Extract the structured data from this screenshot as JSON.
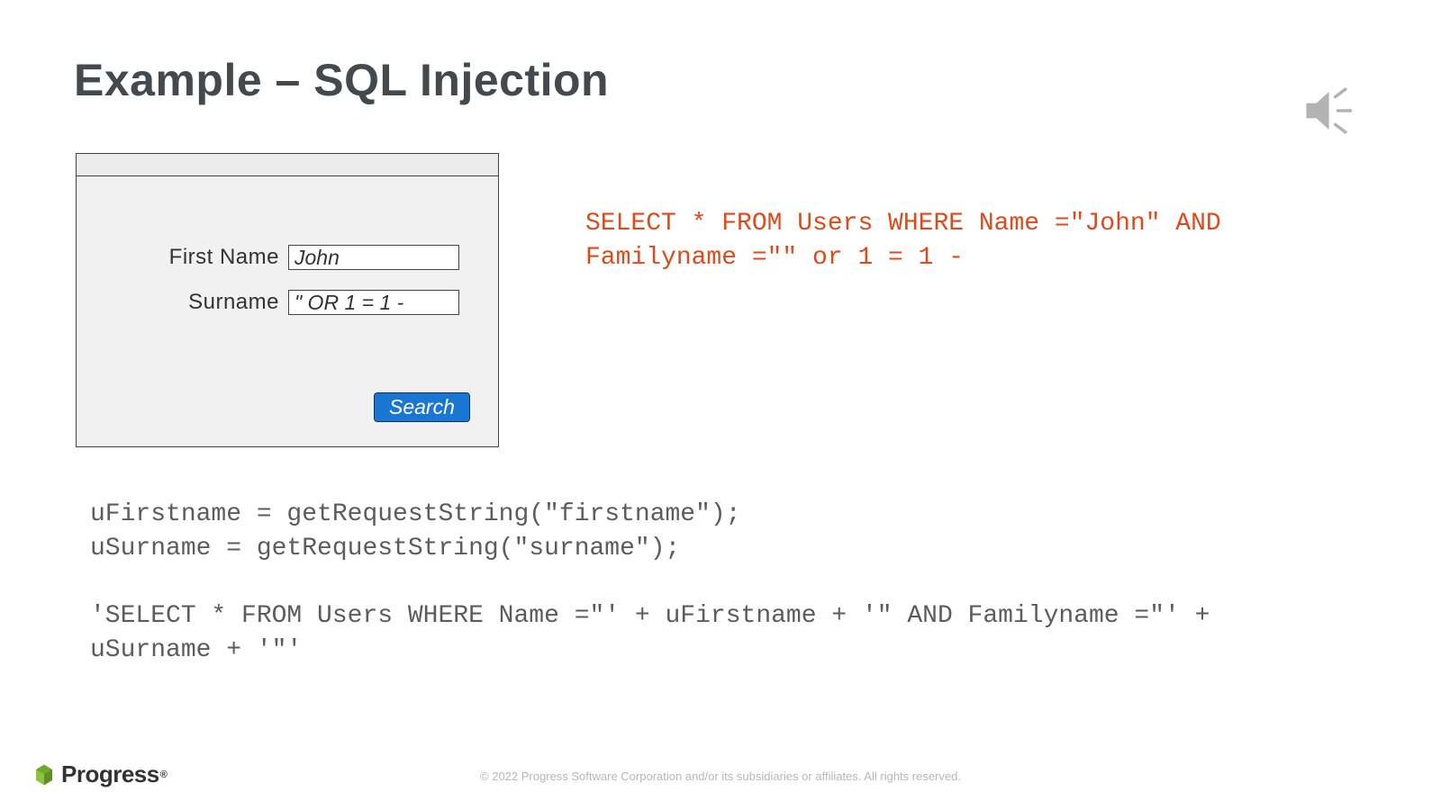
{
  "title": "Example – SQL Injection",
  "form": {
    "firstNameLabel": "First Name",
    "surnameLabel": "Surname",
    "firstNameValue": "John",
    "surnameValue": "\" OR 1 = 1 -",
    "searchLabel": "Search"
  },
  "sqlResult": "SELECT * FROM Users WHERE Name =\"John\" AND Familyname =\"\" or 1 = 1 -",
  "codeBlock": "uFirstname = getRequestString(\"firstname\");\nuSurname = getRequestString(\"surname\");\n\n'SELECT * FROM Users WHERE Name =\"' + uFirstname + '\" AND Familyname =\"' + uSurname + '\"'",
  "footer": {
    "brand": "Progress",
    "copyright": "© 2022 Progress Software Corporation and/or its subsidiaries or affiliates. All rights reserved."
  }
}
